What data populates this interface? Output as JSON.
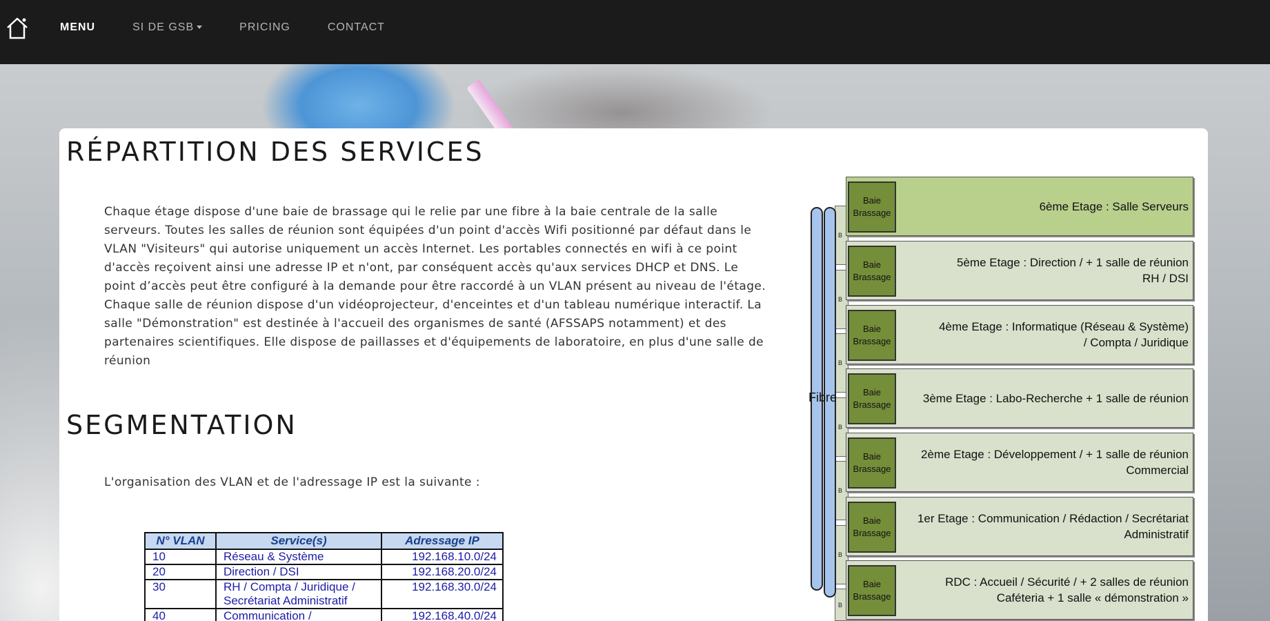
{
  "navbar": {
    "items": [
      {
        "label": "MENU",
        "active": true
      },
      {
        "label": "SI DE GSB",
        "active": false,
        "dropdown": true
      },
      {
        "label": "PRICING",
        "active": false
      },
      {
        "label": "CONTACT",
        "active": false
      }
    ]
  },
  "section1": {
    "title": "RÉPARTITION DES SERVICES",
    "paragraph": "Chaque étage dispose d'une baie de brassage qui le relie par une fibre à la baie centrale de la salle serveurs. Toutes les salles de réunion sont équipées d'un point d'accès Wifi positionné par défaut dans le VLAN \"Visiteurs\" qui autorise uniquement un accès Internet. Les portables connectés en wifi à ce point d'accès reçoivent ainsi une adresse IP et n'ont, par conséquent accès qu'aux services DHCP et DNS. Le point d’accès peut être configuré à la demande pour être raccordé à un VLAN présent au niveau de l'étage. Chaque salle de réunion dispose d'un vidéoprojecteur, d'enceintes et d'un tableau numérique interactif. La salle \"Démonstration\" est destinée à l'accueil des organismes de santé (AFSSAPS notamment) et des partenaires scientifiques. Elle dispose de paillasses et d'équipements de laboratoire, en plus d'une salle de réunion"
  },
  "section2": {
    "title": "SEGMENTATION",
    "intro": "L'organisation des VLAN et de l'adressage IP est la suivante :",
    "table": {
      "headers": [
        "N° VLAN",
        "Service(s)",
        "Adressage IP"
      ],
      "rows": [
        [
          "10",
          "Réseau & Système",
          "192.168.10.0/24"
        ],
        [
          "20",
          "Direction / DSI",
          "192.168.20.0/24"
        ],
        [
          "30",
          "RH / Compta / Juridique / Secrétariat Administratif",
          "192.168.30.0/24"
        ],
        [
          "40",
          "Communication /",
          "192.168.40.0/24"
        ]
      ]
    }
  },
  "diagram": {
    "baie_label": "Baie Brassage",
    "fiber_label": "Fibre",
    "back_strip_label": "B",
    "floors": [
      {
        "label": "6ème Etage : Salle Serveurs"
      },
      {
        "label": "5ème Etage : Direction /   +   1 salle de réunion\nRH / DSI"
      },
      {
        "label": "4ème Etage : Informatique (Réseau & Système)\n/ Compta / Juridique"
      },
      {
        "label": "3ème Etage : Labo-Recherche    +   1 salle de réunion"
      },
      {
        "label": "2ème Etage : Développement  /  +  1 salle de réunion\nCommercial"
      },
      {
        "label": "1er Etage : Communication / Rédaction / Secrétariat\nAdministratif"
      },
      {
        "label": "RDC : Accueil /  Sécurité /     +    2 salles de réunion\nCaféteria        +    1 salle « démonstration »"
      }
    ]
  }
}
